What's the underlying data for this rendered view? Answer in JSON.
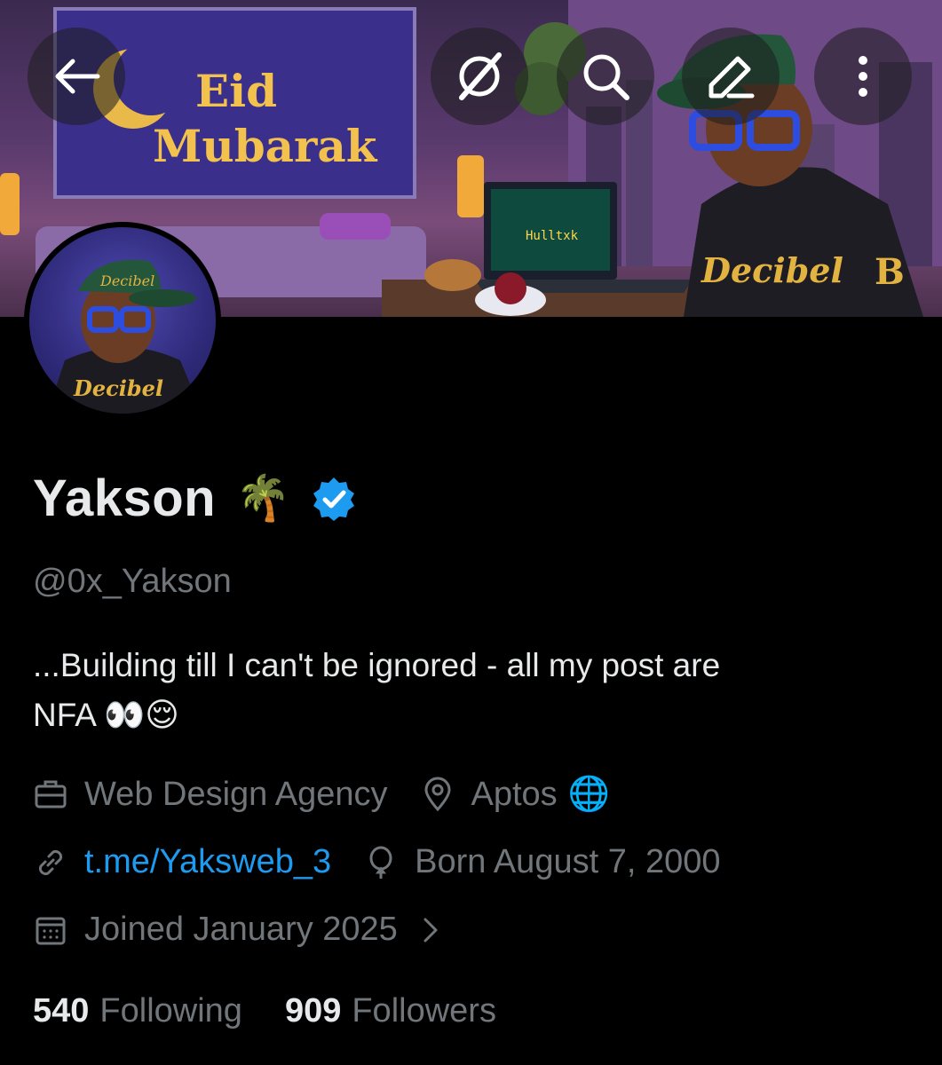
{
  "banner": {
    "sign_line1": "Eid",
    "sign_line2": "Mubarak",
    "jacket_text": "Decibel",
    "jacket_letter": "B",
    "laptop_text": "Hulltxk"
  },
  "avatar": {
    "jacket_text": "Decibel",
    "cap_text": "Decibel"
  },
  "header_icons": [
    "back-arrow-icon",
    "grok-icon",
    "search-icon",
    "edit-icon",
    "more-vertical-icon"
  ],
  "profile": {
    "name": "Yakson",
    "name_emoji": "🌴",
    "verified": true,
    "handle": "@0x_Yakson",
    "bio_line1": "...Building till I can't be ignored - all my post are",
    "bio_line2": "NFA 👀😌",
    "category": "Web Design Agency",
    "location": "Aptos",
    "location_emoji": "🌐",
    "website": "t.me/Yaksweb_3",
    "birthday": "Born August 7, 2000",
    "joined": "Joined January 2025",
    "following_count": "540",
    "following_label": "Following",
    "followers_count": "909",
    "followers_label": "Followers"
  },
  "colors": {
    "link": "#1d9bf0",
    "muted": "#71767b",
    "text": "#e7e9ea",
    "verified": "#1d9bf0"
  }
}
